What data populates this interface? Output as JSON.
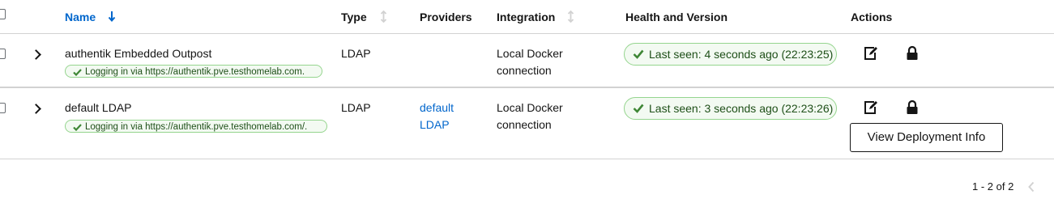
{
  "table": {
    "columns": [
      {
        "label": "Name"
      },
      {
        "label": "Type"
      },
      {
        "label": "Providers"
      },
      {
        "label": "Integration"
      },
      {
        "label": "Health and Version"
      },
      {
        "label": "Actions"
      }
    ],
    "rows": [
      {
        "name": "authentik Embedded Outpost",
        "login_label": "Logging in via https://authentik.pve.testhomelab.com.",
        "type": "LDAP",
        "providers": [],
        "integration_line1": "Local Docker",
        "integration_line2": "connection",
        "health": "Last seen: 4 seconds ago (22:23:25)"
      },
      {
        "name": "default LDAP",
        "login_label": "Logging in via https://authentik.pve.testhomelab.com/.",
        "type": "LDAP",
        "providers": [
          "default",
          "LDAP"
        ],
        "integration_line1": "Local Docker",
        "integration_line2": "connection",
        "health": "Last seen: 3 seconds ago (22:23:26)"
      }
    ]
  },
  "actions": {
    "view_deployment_label": "View Deployment Info"
  },
  "pagination": {
    "range_text": "1 - 2 of 2"
  },
  "icons": {
    "sort_active": "arrow-down-icon",
    "sort_inactive": "sort-icon",
    "expand": "chevron-right-icon",
    "status": "check-icon",
    "edit": "edit-icon",
    "permissions": "lock-icon",
    "prev_page": "chevron-left-icon"
  },
  "colors": {
    "link": "#0066cc",
    "success_border": "#95d58e",
    "success_bg": "#f3faf2",
    "success_text": "#1e4f18",
    "success_icon": "#3e8635"
  }
}
